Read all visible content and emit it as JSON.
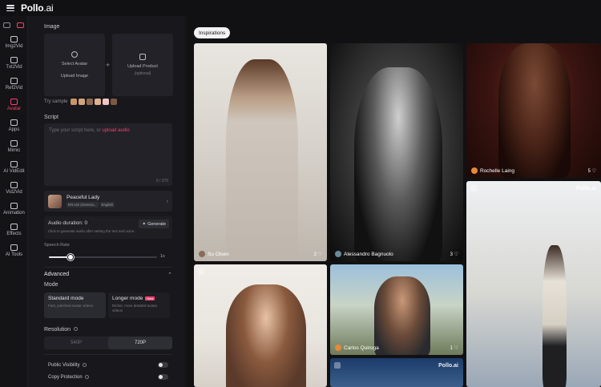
{
  "app": {
    "logo_main": "Pollo",
    "logo_suffix": ".ai"
  },
  "rail": {
    "items": [
      {
        "label": "Img2Vid"
      },
      {
        "label": "Txt2Vid"
      },
      {
        "label": "Ref2Vid"
      },
      {
        "label": "Avatar"
      },
      {
        "label": "Apps"
      },
      {
        "label": "Mimic"
      },
      {
        "label": "AI VidEdit"
      },
      {
        "label": "Vid2Vid"
      },
      {
        "label": "Animation"
      },
      {
        "label": "Effects"
      },
      {
        "label": "AI Tools"
      }
    ],
    "active": "Avatar"
  },
  "form": {
    "image_label": "Image",
    "select_avatar": "Select Avatar",
    "upload_image": "Upload Image",
    "upload_product": "Upload Product",
    "optional": "(optional)",
    "try_sample": "Try sample",
    "sample_colors": [
      "#c9966b",
      "#d2a47c",
      "#8d6a4f",
      "#e0b38f",
      "#f3c6c6",
      "#7a5a44"
    ],
    "script_label": "Script",
    "script_placeholder": "Type your script here, or",
    "script_link": "upload audio",
    "char_count": "0 / 375",
    "voice_name": "Peaceful Lady",
    "voice_tag_1": "EN-US (Genera...",
    "voice_tag_2": "English",
    "audio_duration": "Audio duration: 0",
    "generate": "Generate",
    "audio_hint": "Click to generate audio after setting the text and voice.",
    "speech_rate_label": "Speech Rate",
    "speech_rate_value": "1x",
    "speech_rate_fraction": 0.2,
    "advanced": "Advanced",
    "mode_label": "Mode",
    "mode_standard_title": "Standard mode",
    "mode_standard_desc": "Fast, polished avatar videos",
    "mode_long_title": "Longer mode",
    "mode_long_badge": "New",
    "mode_long_desc": "Richer, more detailed avatar videos",
    "resolution_label": "Resolution",
    "res_540": "540P",
    "res_720": "720P",
    "public_visibility": "Public Visibility",
    "copy_protection": "Copy Protection"
  },
  "gallery": {
    "chip": "Inspirations",
    "cards": [
      {
        "author": "Su Olsen",
        "likes": "2"
      },
      {
        "author": "Alessandro Bagnuolo",
        "likes": "3"
      },
      {
        "author": "Rochelle Laing",
        "likes": "5"
      },
      {
        "author": "Carlos Quiroga",
        "likes": "1"
      }
    ],
    "watermark": "Pollo.ai"
  },
  "colors": {
    "accent": "#ff3d6e",
    "background": "#111114",
    "panel": "#18181c"
  }
}
